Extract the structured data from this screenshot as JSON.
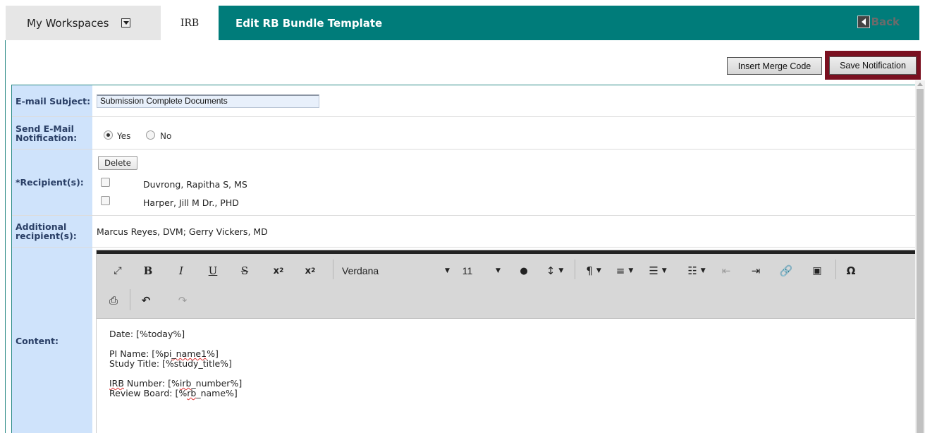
{
  "nav": {
    "workspaces_label": "My Workspaces",
    "irb_tab": "IRB",
    "page_title": "Edit RB Bundle Template",
    "back_label": "Back"
  },
  "actions": {
    "insert_merge_code": "Insert Merge Code",
    "save_notification": "Save Notification"
  },
  "form": {
    "email_subject": {
      "label": "E-mail Subject:",
      "value": "Submission Complete Documents"
    },
    "send_email": {
      "label": "Send E-Mail Notification:",
      "yes": "Yes",
      "no": "No",
      "selected": "Yes"
    },
    "recipients": {
      "label": "*Recipient(s):",
      "delete_label": "Delete",
      "items": [
        "Duvrong, Rapitha S, MS",
        "Harper, Jill M Dr., PHD"
      ]
    },
    "additional": {
      "label": "Additional recipient(s):",
      "value": "Marcus Reyes, DVM; Gerry Vickers, MD"
    },
    "content": {
      "label": "Content:",
      "font_family": "Verdana",
      "font_size": "11",
      "line1": "Date: [%today%]",
      "line2_prefix": "PI Name: [%pi",
      "line2_sq": "_name1",
      "line2_suffix": "%]",
      "line3": "Study Title: [%study_title%]",
      "line4_sq": "IRB",
      "line4_mid": " Number: [%",
      "line4_sq2": "irb",
      "line4_suffix": "_number%]",
      "line5_prefix": "Review Board: [%",
      "line5_sq": "rb",
      "line5_suffix": "_name%]"
    }
  },
  "colors": {
    "accent": "#007c7a",
    "save_border": "#7a1020",
    "label_bg": "#cfe3fb"
  }
}
